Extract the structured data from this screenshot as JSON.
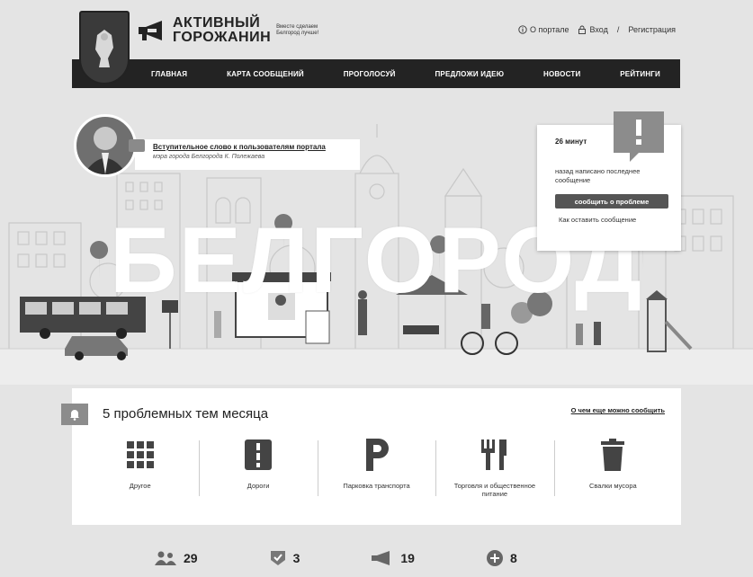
{
  "header": {
    "logo_title_line1": "АКТИВНЫЙ",
    "logo_title_line2": "ГОРОЖАНИН",
    "logo_slogan": "Вместе сделаем Белгород лучше!",
    "links": {
      "about": "О портале",
      "login": "Вход",
      "separator": "/",
      "register": "Регистрация"
    }
  },
  "nav": {
    "items": [
      "ГЛАВНАЯ",
      "КАРТА СООБЩЕНИЙ",
      "ПРОГОЛОСУЙ",
      "ПРЕДЛОЖИ ИДЕЮ",
      "НОВОСТИ",
      "РЕЙТИНГИ"
    ]
  },
  "hero": {
    "city_name": "БЕЛГОРОД",
    "mayor_link": "Вступительное слово к пользователям портала",
    "mayor_caption": "мэра города Белгорода К. Полежаева",
    "notice": {
      "minutes": "26 минут",
      "text": "назад написано последнее сообщение",
      "button": "сообщить о проблеме",
      "how_link": "Как оставить сообщение"
    }
  },
  "problems": {
    "title": "5 проблемных тем месяца",
    "more_link": "О чем еще можно сообщить",
    "categories": [
      {
        "label": "Другое",
        "icon": "grid-icon"
      },
      {
        "label": "Дороги",
        "icon": "road-icon"
      },
      {
        "label": "Парковка транспорта",
        "icon": "parking-icon"
      },
      {
        "label": "Торговля и общественное питание",
        "icon": "fork-knife-icon"
      },
      {
        "label": "Свалки мусора",
        "icon": "trash-icon"
      }
    ]
  },
  "stats": [
    {
      "icon": "users-icon",
      "value": "29"
    },
    {
      "icon": "shield-check-icon",
      "value": "3"
    },
    {
      "icon": "megaphone-icon",
      "value": "19"
    },
    {
      "icon": "plus-circle-icon",
      "value": "8"
    }
  ],
  "colors": {
    "nav_bg": "#232323",
    "accent_gray": "#8c8c8c",
    "page_bg": "#e4e4e4"
  }
}
